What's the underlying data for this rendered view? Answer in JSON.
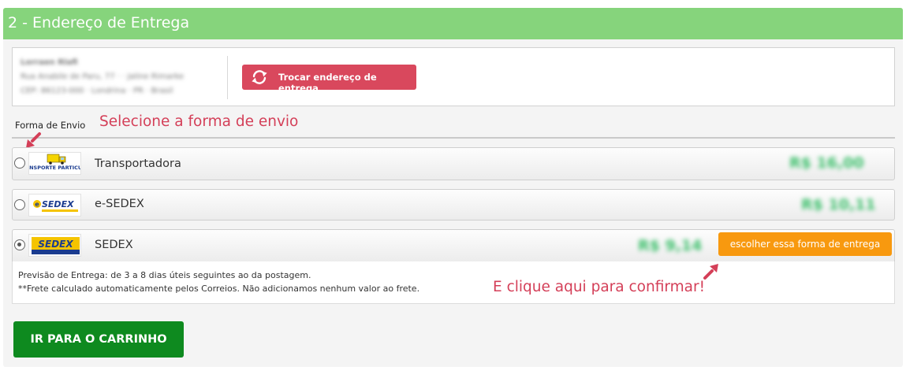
{
  "section": {
    "title": "2 - Endereço de Entrega"
  },
  "address": {
    "lines": [
      "Lorraen Rlafi",
      "Rua Anabile de Paru, 77 · · Jaline Rimarke",
      "CEP: 86123-000 · Londrina · PR · Brasil"
    ],
    "change_button": "Trocar endereço de entrega"
  },
  "shipping": {
    "label": "Forma de Envio",
    "hint_select": "Selecione a forma de envio",
    "options": [
      {
        "name": "Transportadora",
        "price": "R$ 16,00",
        "logo": "TRANSPORTE PARTICULAR",
        "selected": false
      },
      {
        "name": "e-SEDEX",
        "price": "R$ 10,11",
        "logo": "e SEDEX",
        "selected": false
      },
      {
        "name": "SEDEX",
        "price": "R$ 9,14",
        "logo": "SEDEX",
        "selected": true
      }
    ],
    "choose_button": "escolher essa forma de entrega",
    "forecast": "Previsão de Entrega: de 3 a 8 dias úteis seguintes ao da postagem.",
    "note": "**Frete calculado automaticamente pelos Correios. Não adicionamos nenhum valor ao frete.",
    "hint_confirm": "E clique aqui para confirmar!"
  },
  "cart_button": "IR PARA O CARRINHO",
  "colors": {
    "header_green": "#86d47c",
    "change_red": "#d9485d",
    "hint_red": "#d43f58",
    "choose_orange": "#f8990f",
    "cart_green": "#0e8a1f"
  },
  "icons": [
    "refresh-icon",
    "pointer-arrow-icon",
    "truck-logo",
    "esedex-logo",
    "sedex-logo"
  ]
}
